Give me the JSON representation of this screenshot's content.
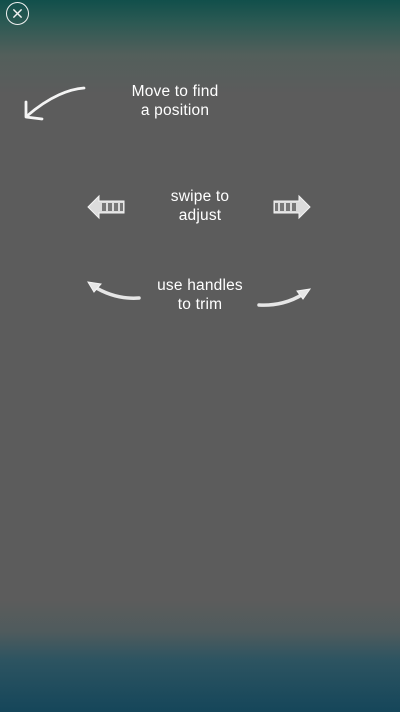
{
  "header": {
    "close_icon": "close-icon"
  },
  "hints": {
    "move_line1": "Move to find",
    "move_line2": "a position",
    "swipe_line1": "swipe to",
    "swipe_line2": "adjust",
    "trim_line1": "use handles",
    "trim_line2": "to trim"
  },
  "icons": {
    "move": "curved-arrow-left-icon",
    "swipe_left": "filmstrip-arrow-left-icon",
    "swipe_right": "filmstrip-arrow-right-icon",
    "trim_left": "handle-arrow-left-icon",
    "trim_right": "handle-arrow-right-icon"
  },
  "colors": {
    "background": "#5c5c5c",
    "top_tint": "#114f4b",
    "bottom_tint": "#15465a",
    "text": "#ffffff"
  }
}
